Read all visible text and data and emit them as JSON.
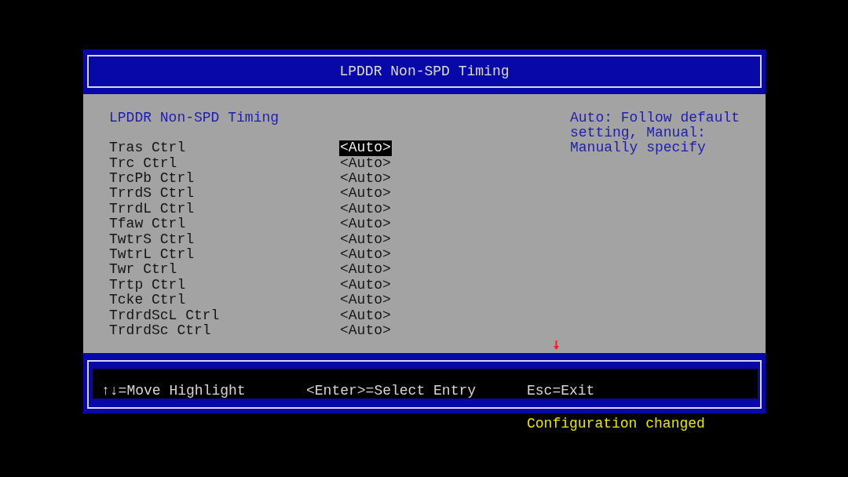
{
  "header": {
    "title": "LPDDR Non-SPD Timing"
  },
  "form": {
    "heading": "LPDDR Non-SPD Timing",
    "items": [
      {
        "label": "Tras Ctrl",
        "value": "<Auto>",
        "selected": true
      },
      {
        "label": "Trc Ctrl",
        "value": "<Auto>",
        "selected": false
      },
      {
        "label": "TrcPb Ctrl",
        "value": "<Auto>",
        "selected": false
      },
      {
        "label": "TrrdS Ctrl",
        "value": "<Auto>",
        "selected": false
      },
      {
        "label": "TrrdL Ctrl",
        "value": "<Auto>",
        "selected": false
      },
      {
        "label": "Tfaw Ctrl",
        "value": "<Auto>",
        "selected": false
      },
      {
        "label": "TwtrS Ctrl",
        "value": "<Auto>",
        "selected": false
      },
      {
        "label": "TwtrL Ctrl",
        "value": "<Auto>",
        "selected": false
      },
      {
        "label": "Twr Ctrl",
        "value": "<Auto>",
        "selected": false
      },
      {
        "label": "Trtp Ctrl",
        "value": "<Auto>",
        "selected": false
      },
      {
        "label": "Tcke Ctrl",
        "value": "<Auto>",
        "selected": false
      },
      {
        "label": "TrdrdScL Ctrl",
        "value": "<Auto>",
        "selected": false
      },
      {
        "label": "TrdrdSc Ctrl",
        "value": "<Auto>",
        "selected": false
      }
    ]
  },
  "help": {
    "text": "Auto: Follow default setting, Manual: Manually specify"
  },
  "footer": {
    "hints": [
      "↑↓=Move Highlight",
      "<Enter>=Select Entry",
      "Esc=Exit"
    ]
  },
  "status": {
    "message": "Configuration changed"
  }
}
